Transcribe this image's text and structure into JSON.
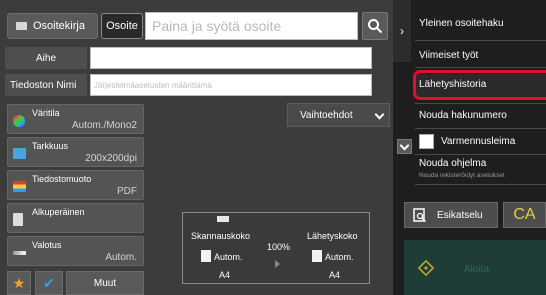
{
  "topbar": {
    "address_book": "Osoitekirja",
    "address": "Osoite",
    "address_placeholder": "Paina ja syötä osoite"
  },
  "fields": {
    "subject_label": "Aihe",
    "subject_value": "",
    "filename_label": "Tiedoston Nimi",
    "filename_placeholder": "Järjestelmäasetusten määrittämä"
  },
  "settings": [
    {
      "title": "Väritila",
      "value": "Autom./Mono2"
    },
    {
      "title": "Tarkkuus",
      "value": "200x200dpi"
    },
    {
      "title": "Tiedostomuoto",
      "value": "PDF"
    },
    {
      "title": "Alkuperäinen",
      "value": ""
    },
    {
      "title": "Valotus",
      "value": "Autom."
    }
  ],
  "options_label": "Vaihtoehdot",
  "preview": {
    "scan_size_label": "Skannauskoko",
    "scan_mode": "Autom.",
    "scan_paper": "A4",
    "ratio": "100%",
    "send_size_label": "Lähetyskoko",
    "send_mode": "Autom.",
    "send_paper": "A4"
  },
  "bottom": {
    "more": "Muut"
  },
  "right_menu": {
    "items": [
      "Yleinen osoitehaku",
      "Viimeiset työt",
      "Lähetyshistoria",
      "Nouda hakunumero",
      "Varmennusleima",
      "Nouda ohjelma"
    ],
    "retrieve_program_sub": "Nouda rekisteröidyt asetukset"
  },
  "actions": {
    "preview": "Esikatselu",
    "ca": "CA",
    "start": "Aloita"
  },
  "colors": {
    "highlight": "#e0102a",
    "ca_text": "#e0d23a",
    "start_bg": "#1f3d36"
  }
}
